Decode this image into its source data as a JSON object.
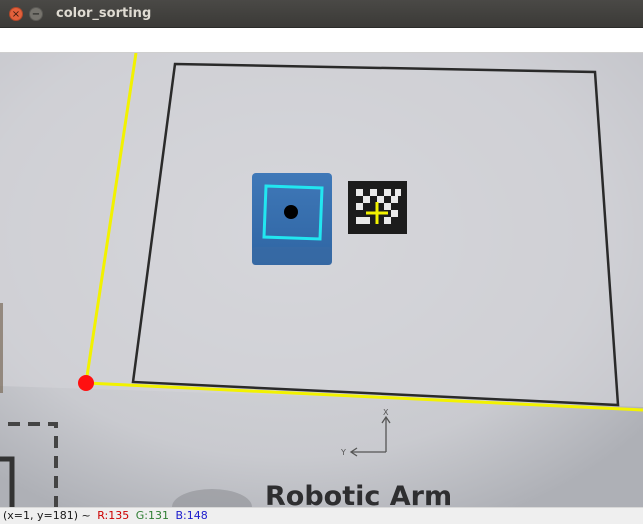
{
  "window": {
    "title": "color_sorting",
    "close_glyph": "×",
    "minimize_glyph": "−"
  },
  "scene": {
    "label_text": "Robotic Arm",
    "axis_x_label": "X",
    "axis_y_label": "Y",
    "overlay_colors": {
      "workspace_lines": "#f2f200",
      "origin_marker": "#ff1010",
      "block_contour": "#22e6f0",
      "block_center": "#000000",
      "target_cross": "#f2f200"
    }
  },
  "status": {
    "coords": "(x=1, y=181) ~",
    "r": "R:135",
    "g": "G:131",
    "b": "B:148",
    "colors": {
      "r": "#cc0000",
      "g": "#2e7d32",
      "b": "#1a1acc"
    }
  }
}
